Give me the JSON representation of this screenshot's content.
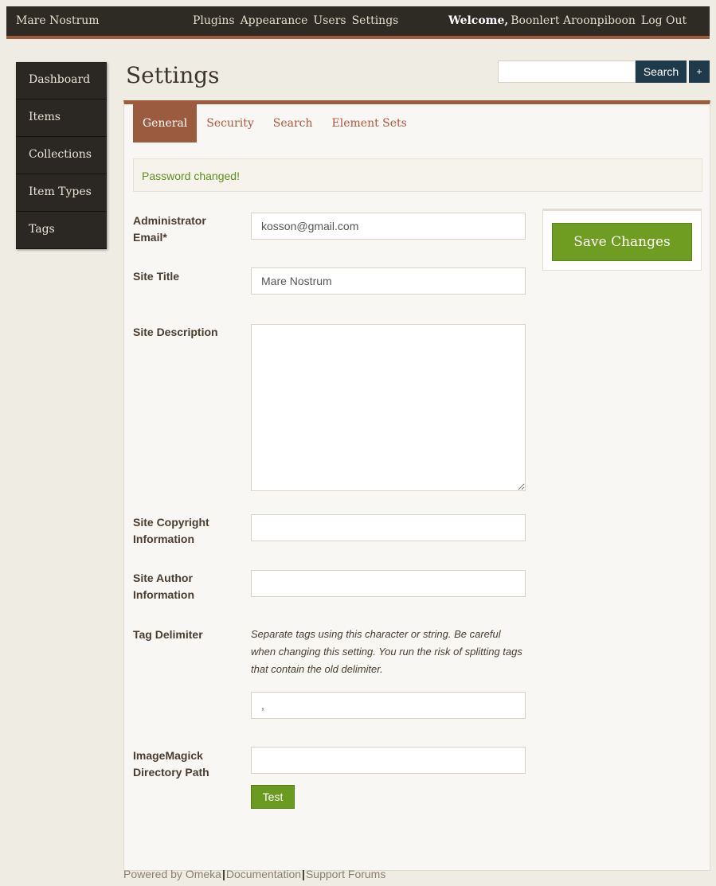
{
  "header": {
    "site_name": "Mare Nostrum",
    "nav": [
      "Plugins",
      "Appearance",
      "Users",
      "Settings"
    ],
    "welcome_label": "Welcome,",
    "user_name": "Boonlert Aroonpiboon",
    "logout_label": "Log Out"
  },
  "sidebar": {
    "items": [
      {
        "label": "Dashboard"
      },
      {
        "label": "Items"
      },
      {
        "label": "Collections"
      },
      {
        "label": "Item Types"
      },
      {
        "label": "Tags"
      }
    ]
  },
  "page": {
    "title": "Settings"
  },
  "search": {
    "value": "",
    "button_label": "Search",
    "advanced_label": "+"
  },
  "tabs": [
    {
      "label": "General",
      "active": true
    },
    {
      "label": "Security",
      "active": false
    },
    {
      "label": "Search",
      "active": false
    },
    {
      "label": "Element Sets",
      "active": false
    }
  ],
  "flash": {
    "message": "Password changed!"
  },
  "form": {
    "admin_email": {
      "label": "Administrator Email*",
      "value": "kosson@gmail.com"
    },
    "site_title": {
      "label": "Site Title",
      "value": "Mare Nostrum"
    },
    "site_description": {
      "label": "Site Description",
      "value": ""
    },
    "copyright": {
      "label": "Site Copyright Information",
      "value": ""
    },
    "author": {
      "label": "Site Author Information",
      "value": ""
    },
    "tag_delimiter": {
      "label": "Tag Delimiter",
      "help": "Separate tags using this character or string. Be careful when changing this setting. You run the risk of splitting tags that contain the old delimiter.",
      "value": ","
    },
    "imagemagick": {
      "label": "ImageMagick Directory Path",
      "value": "",
      "test_label": "Test"
    }
  },
  "save": {
    "label": "Save Changes"
  },
  "footer": {
    "powered_by": "Powered by Omeka",
    "documentation": "Documentation",
    "support": "Support Forums",
    "separator": "|"
  },
  "colors": {
    "accent": "#9a5b3e",
    "topbar": "#2e2a24",
    "save_green": "#6f9d22",
    "search_blue": "#1f3a4a",
    "success_text": "#5f8f1e"
  }
}
